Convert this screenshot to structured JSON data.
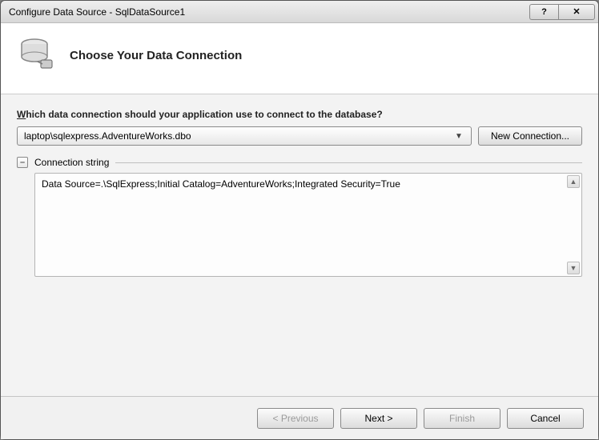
{
  "title": "Configure Data Source - SqlDataSource1",
  "header": {
    "title": "Choose Your Data Connection"
  },
  "prompt": "Which data connection should your application use to connect to the database?",
  "dropdown": {
    "selected": "laptop\\sqlexpress.AdventureWorks.dbo"
  },
  "newConnectionLabel": "New Connection...",
  "expander": {
    "symbol": "–",
    "label": "Connection string"
  },
  "connectionString": "Data Source=.\\SqlExpress;Initial Catalog=AdventureWorks;Integrated Security=True",
  "buttons": {
    "previous": "< Previous",
    "next": "Next >",
    "finish": "Finish",
    "cancel": "Cancel"
  },
  "titlebar": {
    "help": "?",
    "close": "✕"
  }
}
